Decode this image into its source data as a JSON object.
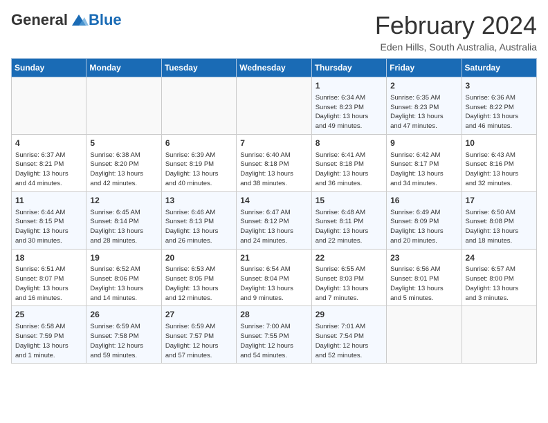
{
  "header": {
    "logo_general": "General",
    "logo_blue": "Blue",
    "month_title": "February 2024",
    "location": "Eden Hills, South Australia, Australia"
  },
  "weekdays": [
    "Sunday",
    "Monday",
    "Tuesday",
    "Wednesday",
    "Thursday",
    "Friday",
    "Saturday"
  ],
  "weeks": [
    [
      {
        "day": "",
        "info": ""
      },
      {
        "day": "",
        "info": ""
      },
      {
        "day": "",
        "info": ""
      },
      {
        "day": "",
        "info": ""
      },
      {
        "day": "1",
        "info": "Sunrise: 6:34 AM\nSunset: 8:23 PM\nDaylight: 13 hours\nand 49 minutes."
      },
      {
        "day": "2",
        "info": "Sunrise: 6:35 AM\nSunset: 8:23 PM\nDaylight: 13 hours\nand 47 minutes."
      },
      {
        "day": "3",
        "info": "Sunrise: 6:36 AM\nSunset: 8:22 PM\nDaylight: 13 hours\nand 46 minutes."
      }
    ],
    [
      {
        "day": "4",
        "info": "Sunrise: 6:37 AM\nSunset: 8:21 PM\nDaylight: 13 hours\nand 44 minutes."
      },
      {
        "day": "5",
        "info": "Sunrise: 6:38 AM\nSunset: 8:20 PM\nDaylight: 13 hours\nand 42 minutes."
      },
      {
        "day": "6",
        "info": "Sunrise: 6:39 AM\nSunset: 8:19 PM\nDaylight: 13 hours\nand 40 minutes."
      },
      {
        "day": "7",
        "info": "Sunrise: 6:40 AM\nSunset: 8:18 PM\nDaylight: 13 hours\nand 38 minutes."
      },
      {
        "day": "8",
        "info": "Sunrise: 6:41 AM\nSunset: 8:18 PM\nDaylight: 13 hours\nand 36 minutes."
      },
      {
        "day": "9",
        "info": "Sunrise: 6:42 AM\nSunset: 8:17 PM\nDaylight: 13 hours\nand 34 minutes."
      },
      {
        "day": "10",
        "info": "Sunrise: 6:43 AM\nSunset: 8:16 PM\nDaylight: 13 hours\nand 32 minutes."
      }
    ],
    [
      {
        "day": "11",
        "info": "Sunrise: 6:44 AM\nSunset: 8:15 PM\nDaylight: 13 hours\nand 30 minutes."
      },
      {
        "day": "12",
        "info": "Sunrise: 6:45 AM\nSunset: 8:14 PM\nDaylight: 13 hours\nand 28 minutes."
      },
      {
        "day": "13",
        "info": "Sunrise: 6:46 AM\nSunset: 8:13 PM\nDaylight: 13 hours\nand 26 minutes."
      },
      {
        "day": "14",
        "info": "Sunrise: 6:47 AM\nSunset: 8:12 PM\nDaylight: 13 hours\nand 24 minutes."
      },
      {
        "day": "15",
        "info": "Sunrise: 6:48 AM\nSunset: 8:11 PM\nDaylight: 13 hours\nand 22 minutes."
      },
      {
        "day": "16",
        "info": "Sunrise: 6:49 AM\nSunset: 8:09 PM\nDaylight: 13 hours\nand 20 minutes."
      },
      {
        "day": "17",
        "info": "Sunrise: 6:50 AM\nSunset: 8:08 PM\nDaylight: 13 hours\nand 18 minutes."
      }
    ],
    [
      {
        "day": "18",
        "info": "Sunrise: 6:51 AM\nSunset: 8:07 PM\nDaylight: 13 hours\nand 16 minutes."
      },
      {
        "day": "19",
        "info": "Sunrise: 6:52 AM\nSunset: 8:06 PM\nDaylight: 13 hours\nand 14 minutes."
      },
      {
        "day": "20",
        "info": "Sunrise: 6:53 AM\nSunset: 8:05 PM\nDaylight: 13 hours\nand 12 minutes."
      },
      {
        "day": "21",
        "info": "Sunrise: 6:54 AM\nSunset: 8:04 PM\nDaylight: 13 hours\nand 9 minutes."
      },
      {
        "day": "22",
        "info": "Sunrise: 6:55 AM\nSunset: 8:03 PM\nDaylight: 13 hours\nand 7 minutes."
      },
      {
        "day": "23",
        "info": "Sunrise: 6:56 AM\nSunset: 8:01 PM\nDaylight: 13 hours\nand 5 minutes."
      },
      {
        "day": "24",
        "info": "Sunrise: 6:57 AM\nSunset: 8:00 PM\nDaylight: 13 hours\nand 3 minutes."
      }
    ],
    [
      {
        "day": "25",
        "info": "Sunrise: 6:58 AM\nSunset: 7:59 PM\nDaylight: 13 hours\nand 1 minute."
      },
      {
        "day": "26",
        "info": "Sunrise: 6:59 AM\nSunset: 7:58 PM\nDaylight: 12 hours\nand 59 minutes."
      },
      {
        "day": "27",
        "info": "Sunrise: 6:59 AM\nSunset: 7:57 PM\nDaylight: 12 hours\nand 57 minutes."
      },
      {
        "day": "28",
        "info": "Sunrise: 7:00 AM\nSunset: 7:55 PM\nDaylight: 12 hours\nand 54 minutes."
      },
      {
        "day": "29",
        "info": "Sunrise: 7:01 AM\nSunset: 7:54 PM\nDaylight: 12 hours\nand 52 minutes."
      },
      {
        "day": "",
        "info": ""
      },
      {
        "day": "",
        "info": ""
      }
    ]
  ]
}
